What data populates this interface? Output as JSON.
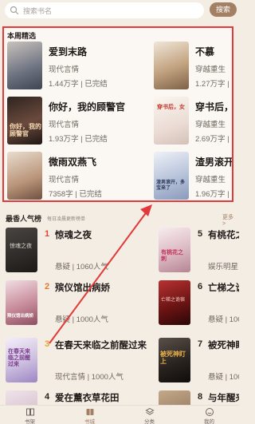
{
  "search": {
    "placeholder": "搜索书名",
    "button": "搜索"
  },
  "weekly": {
    "title": "本周精选",
    "picks": [
      {
        "title": "爱到末路",
        "genre": "现代言情",
        "meta": "1.44万字 | 已完结",
        "cover_color": "#8a8f97"
      },
      {
        "title": "不慕",
        "genre": "穿越重生",
        "meta": "1.27万字 | 已完结",
        "cover_color": "#c8b8a0"
      },
      {
        "title": "你好，我的顾警官",
        "genre": "现代言情",
        "meta": "1.93万字 | 已完结",
        "cover_color": "#5b3f34",
        "cover_text": "你好，我的顾警官"
      },
      {
        "title": "穿书后，女",
        "genre": "穿越重生",
        "meta": "2.69万字 | 已完结",
        "cover_color": "#efe7e0",
        "cover_text": "穿书后，女"
      },
      {
        "title": "微雨双燕飞",
        "genre": "现代言情",
        "meta": "7358字 | 已完结",
        "cover_color": "#d7bfa8"
      },
      {
        "title": "渣男滚开，",
        "genre": "穿越重生",
        "meta": "1.96万字 | 已完结",
        "cover_color": "#cfd7e6",
        "cover_text": "渣男滚开，多宝来了"
      }
    ]
  },
  "popular": {
    "title": "最香人气榜",
    "subtitle": "每日凌晨更新榜单",
    "more": "更多 >",
    "items": [
      {
        "rank": "1",
        "title": "惊魂之夜",
        "meta": "悬疑 | 1060人气",
        "cover_color": "#2a2623",
        "cover_text": "惊魂之夜",
        "rank_color": "#e0463b"
      },
      {
        "rank": "5",
        "title": "有桃花之刺",
        "meta": "娱乐明星 | 1万人气",
        "cover_color": "#e9d7d6",
        "cover_text": "有桃花之刺",
        "rank_color": "#2b2320"
      },
      {
        "rank": "2",
        "title": "殡仪馆出病娇",
        "meta": "悬疑 | 1000人气",
        "cover_color": "#c99aa3",
        "cover_text": "殡仪馆出病娇",
        "rank_color": "#e07a32"
      },
      {
        "rank": "6",
        "title": "亡梯之诡宿",
        "meta": "悬疑 | 1000人气",
        "cover_color": "#7c1d1d",
        "cover_text": "亡梯之诡宿",
        "rank_color": "#2b2320"
      },
      {
        "rank": "3",
        "title": "在春天来临之前醒过来",
        "meta": "现代言情 | 1000人气",
        "cover_color": "#d6cfe3",
        "cover_text": "在春天来临之前醒过来",
        "rank_color": "#e2a632"
      },
      {
        "rank": "7",
        "title": "被死神盯上",
        "meta": "悬疑 | 1000人气",
        "cover_color": "#3a3430",
        "cover_text": "被死神盯上",
        "rank_color": "#2b2320"
      },
      {
        "rank": "4",
        "title": "爱在薰衣草花田",
        "meta": "",
        "cover_color": "#d9c6d4",
        "rank_color": "#2b2320"
      },
      {
        "rank": "8",
        "title": "与年醒来事",
        "meta": "",
        "cover_color": "#9a7f66",
        "rank_color": "#2b2320"
      }
    ]
  },
  "tabs": [
    {
      "label": "书架",
      "icon": "bookshelf-icon"
    },
    {
      "label": "书城",
      "icon": "bookstore-icon",
      "active": true
    },
    {
      "label": "分类",
      "icon": "category-icon"
    },
    {
      "label": "我的",
      "icon": "profile-icon"
    }
  ],
  "colors": {
    "accent": "#a37f64",
    "highlight_border": "#e23a3a",
    "background": "#f4ede4"
  }
}
